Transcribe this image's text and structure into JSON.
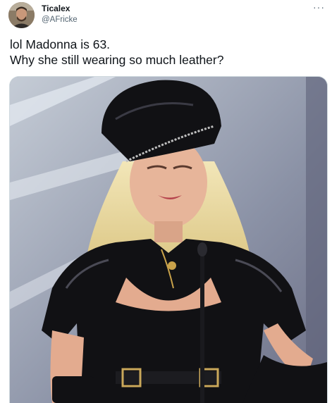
{
  "author": {
    "display_name": "Ticalex",
    "handle": "@AFricke",
    "avatar_icon": "user-avatar"
  },
  "menu_icon": "more-options-icon",
  "tweet": {
    "lines": [
      "lol Madonna is 63.",
      "Why she still wearing so much leather?"
    ]
  },
  "media": {
    "type": "photo",
    "colors": {
      "backdrop": "#8f95a6",
      "leather": "#111114",
      "hair": "#e8d69a",
      "skin": "#e7b59a"
    }
  }
}
